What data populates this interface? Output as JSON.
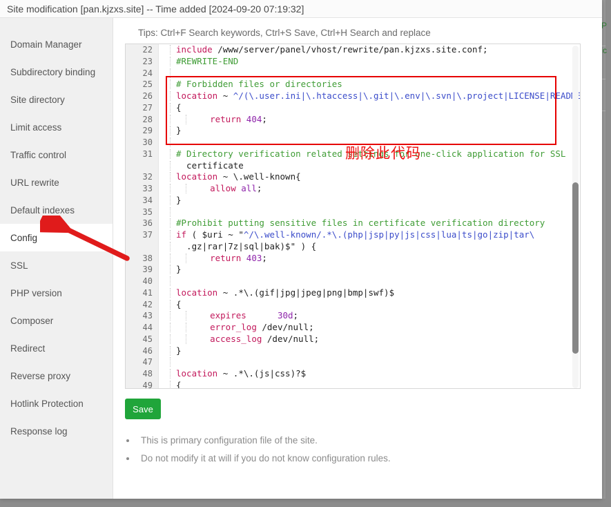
{
  "window": {
    "title": "Site modification [pan.kjzxs.site] -- Time added [2024-09-20 07:19:32]"
  },
  "sidebar": {
    "items": [
      {
        "label": "Domain Manager",
        "active": false
      },
      {
        "label": "Subdirectory binding",
        "active": false
      },
      {
        "label": "Site directory",
        "active": false
      },
      {
        "label": "Limit access",
        "active": false
      },
      {
        "label": "Traffic control",
        "active": false
      },
      {
        "label": "URL rewrite",
        "active": false
      },
      {
        "label": "Default indexes",
        "active": false
      },
      {
        "label": "Config",
        "active": true
      },
      {
        "label": "SSL",
        "active": false
      },
      {
        "label": "PHP version",
        "active": false
      },
      {
        "label": "Composer",
        "active": false
      },
      {
        "label": "Redirect",
        "active": false
      },
      {
        "label": "Reverse proxy",
        "active": false
      },
      {
        "label": "Hotlink Protection",
        "active": false
      },
      {
        "label": "Response log",
        "active": false
      }
    ]
  },
  "content": {
    "tips": "Tips: Ctrl+F Search keywords, Ctrl+S Save, Ctrl+H Search and replace",
    "save_label": "Save",
    "notes": [
      "This is primary configuration file of the site.",
      "Do not modify it at will if you do not know configuration rules."
    ]
  },
  "editor": {
    "first_line": 22,
    "lines": [
      {
        "n": "22",
        "text": "include /www/server/panel/vhost/rewrite/pan.kjzxs.site.conf;"
      },
      {
        "n": "23",
        "text": "#REWRITE-END"
      },
      {
        "n": "24",
        "text": ""
      },
      {
        "n": "25",
        "text": "# Forbidden files or directories"
      },
      {
        "n": "26",
        "text": "location ~ ^/(\\.user.ini|\\.htaccess|\\.git|\\.env|\\.svn|\\.project|LICENSE|README.md)"
      },
      {
        "n": "27",
        "text": "{"
      },
      {
        "n": "28",
        "text": "    return 404;"
      },
      {
        "n": "29",
        "text": "}"
      },
      {
        "n": "30",
        "text": ""
      },
      {
        "n": "31",
        "text": "# Directory verification related settings for one-click application for SSL"
      },
      {
        "n": "",
        "text": "  certificate"
      },
      {
        "n": "32",
        "text": "location ~ \\.well-known{"
      },
      {
        "n": "33",
        "text": "    allow all;"
      },
      {
        "n": "34",
        "text": "}"
      },
      {
        "n": "35",
        "text": ""
      },
      {
        "n": "36",
        "text": "#Prohibit putting sensitive files in certificate verification directory"
      },
      {
        "n": "37",
        "text": "if ( $uri ~ \"^/\\.well-known/.*\\.(php|jsp|py|js|css|lua|ts|go|zip|tar\\"
      },
      {
        "n": "",
        "text": "  .gz|rar|7z|sql|bak)$\" ) {"
      },
      {
        "n": "38",
        "text": "    return 403;"
      },
      {
        "n": "39",
        "text": "}"
      },
      {
        "n": "40",
        "text": ""
      },
      {
        "n": "41",
        "text": "location ~ .*\\.(gif|jpg|jpeg|png|bmp|swf)$"
      },
      {
        "n": "42",
        "text": "{"
      },
      {
        "n": "43",
        "text": "    expires      30d;"
      },
      {
        "n": "44",
        "text": "    error_log /dev/null;"
      },
      {
        "n": "45",
        "text": "    access_log /dev/null;"
      },
      {
        "n": "46",
        "text": "}"
      },
      {
        "n": "47",
        "text": ""
      },
      {
        "n": "48",
        "text": "location ~ .*\\.(js|css)?$"
      },
      {
        "n": "49",
        "text": "{"
      }
    ]
  },
  "annotations": {
    "chinese_note": "删除此代码",
    "red_box_color": "#e60000",
    "arrow_color": "#e01b1b"
  },
  "background_page": {
    "labels": [
      "PHP",
      "tatic"
    ]
  }
}
